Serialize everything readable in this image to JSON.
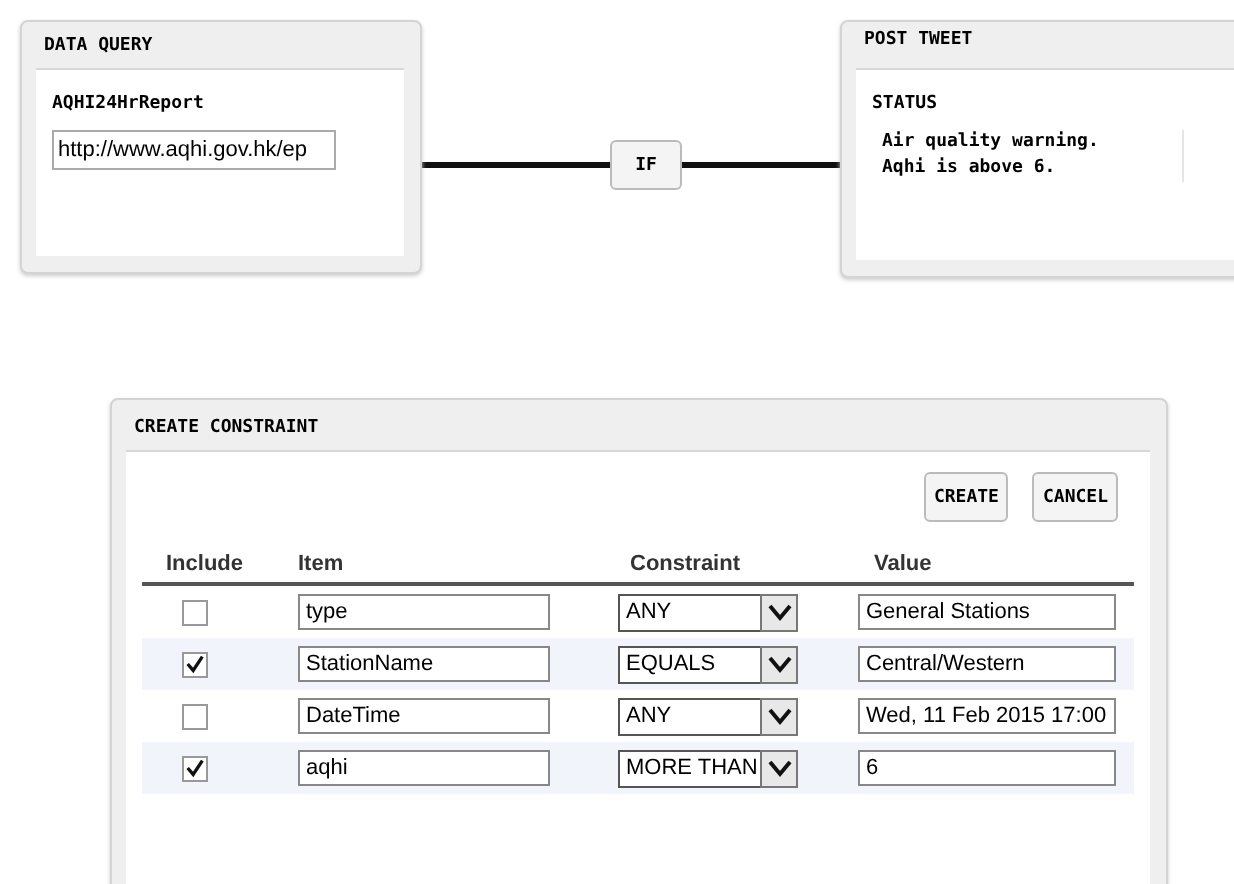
{
  "data_query": {
    "title": "DATA QUERY",
    "label": "AQHI24HrReport",
    "url": "http://www.aqhi.gov.hk/ep"
  },
  "connector": {
    "label": "IF"
  },
  "post_tweet": {
    "title": "POST TWEET",
    "label": "STATUS",
    "status": "Air quality warning.\nAqhi is above 6."
  },
  "constraint_panel": {
    "title": "CREATE CONSTRAINT",
    "buttons": [
      "CREATE",
      "CANCEL"
    ],
    "columns": [
      "Include",
      "Item",
      "Constraint",
      "Value"
    ],
    "rows": [
      {
        "include": false,
        "item": "type",
        "constraint": "ANY",
        "value": "General Stations"
      },
      {
        "include": true,
        "item": "StationName",
        "constraint": "EQUALS",
        "value": "Central/Western"
      },
      {
        "include": false,
        "item": "DateTime",
        "constraint": "ANY",
        "value": "Wed, 11 Feb 2015 17:00"
      },
      {
        "include": true,
        "item": "aqhi",
        "constraint": "MORE THAN",
        "value": "6"
      }
    ]
  }
}
